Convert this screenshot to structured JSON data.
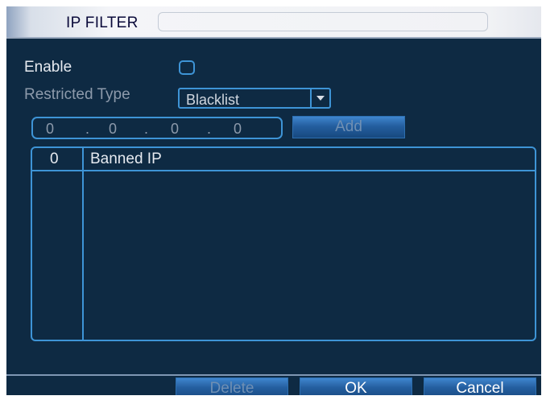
{
  "window": {
    "title": "IP FILTER"
  },
  "form": {
    "enable_label": "Enable",
    "enable_checked": false,
    "restricted_type_label": "Restricted Type",
    "restricted_type_value": "Blacklist",
    "ip_address": {
      "octets": [
        "0",
        "0",
        "0",
        "0"
      ],
      "dot": "."
    },
    "add_label": "Add"
  },
  "table": {
    "count": "0",
    "column_header": "Banned IP",
    "rows": []
  },
  "footer": {
    "delete_label": "Delete",
    "ok_label": "OK",
    "cancel_label": "Cancel"
  }
}
